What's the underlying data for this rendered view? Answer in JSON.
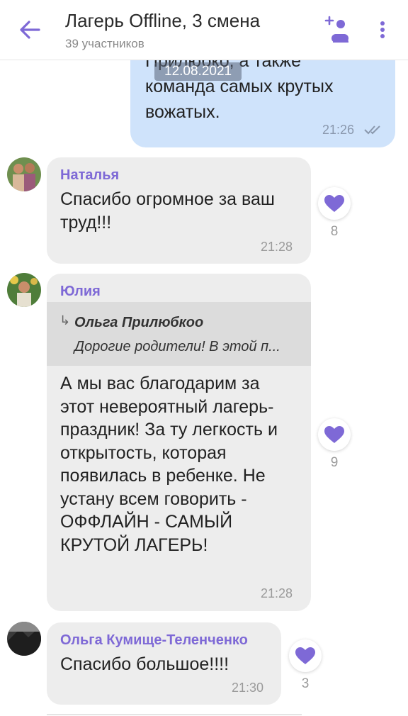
{
  "header": {
    "title": "Лагерь Offline, 3 смена",
    "subtitle": "39 участников"
  },
  "outgoing": {
    "text": "Прилюбко, а также\nкоманда самых крутых\nвожатых.",
    "time": "21:26"
  },
  "date_pill": "12.08.2021",
  "messages": [
    {
      "name": "Наталья",
      "text": "Спасибо огромное за ваш труд!!!",
      "time": "21:28",
      "likes": "8"
    },
    {
      "name": "Юлия",
      "reply_author": "Ольга Прилюбкоо",
      "reply_text": "Дорогие родители! В этой п...",
      "text": "А мы вас благодарим за этот невероятный лагерь-праздник! За ту легкость и открытость, которая появилась в ребенке. Не устану всем говорить - ОФФЛАЙН - САМЫЙ КРУТОЙ ЛАГЕРЬ!",
      "time": "21:28",
      "likes": "9"
    },
    {
      "name": "Ольга Кумище-Теленченко",
      "text": "Спасибо большое!!!!",
      "time": "21:30",
      "likes": "3"
    }
  ],
  "colors": {
    "accent": "#7e69d6",
    "outgoing_bubble": "#cfe3fb",
    "incoming_bubble": "#ededed"
  }
}
